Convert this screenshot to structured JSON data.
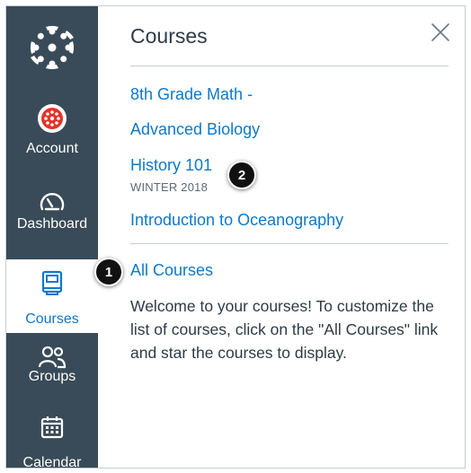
{
  "nav": {
    "items": [
      {
        "label": "Account",
        "icon": "avatar-icon"
      },
      {
        "label": "Dashboard",
        "icon": "speedometer-icon"
      },
      {
        "label": "Courses",
        "icon": "book-icon",
        "active": true
      },
      {
        "label": "Groups",
        "icon": "people-icon"
      },
      {
        "label": "Calendar",
        "icon": "calendar-icon"
      }
    ],
    "colors": {
      "background": "#394b58",
      "active_text": "#0f78c9",
      "logo_ring": "#e4332a"
    }
  },
  "tray": {
    "title": "Courses",
    "courses": [
      {
        "name": "8th Grade Math -"
      },
      {
        "name": "Advanced Biology"
      },
      {
        "name": "History 101",
        "term": "WINTER 2018"
      },
      {
        "name": "Introduction to Oceanography"
      }
    ],
    "all_courses_label": "All Courses",
    "info_text": "Welcome to your courses! To customize the list of courses, click on the \"All Courses\" link and star the courses to display."
  },
  "markers": {
    "all_courses": "1",
    "history": "2"
  }
}
